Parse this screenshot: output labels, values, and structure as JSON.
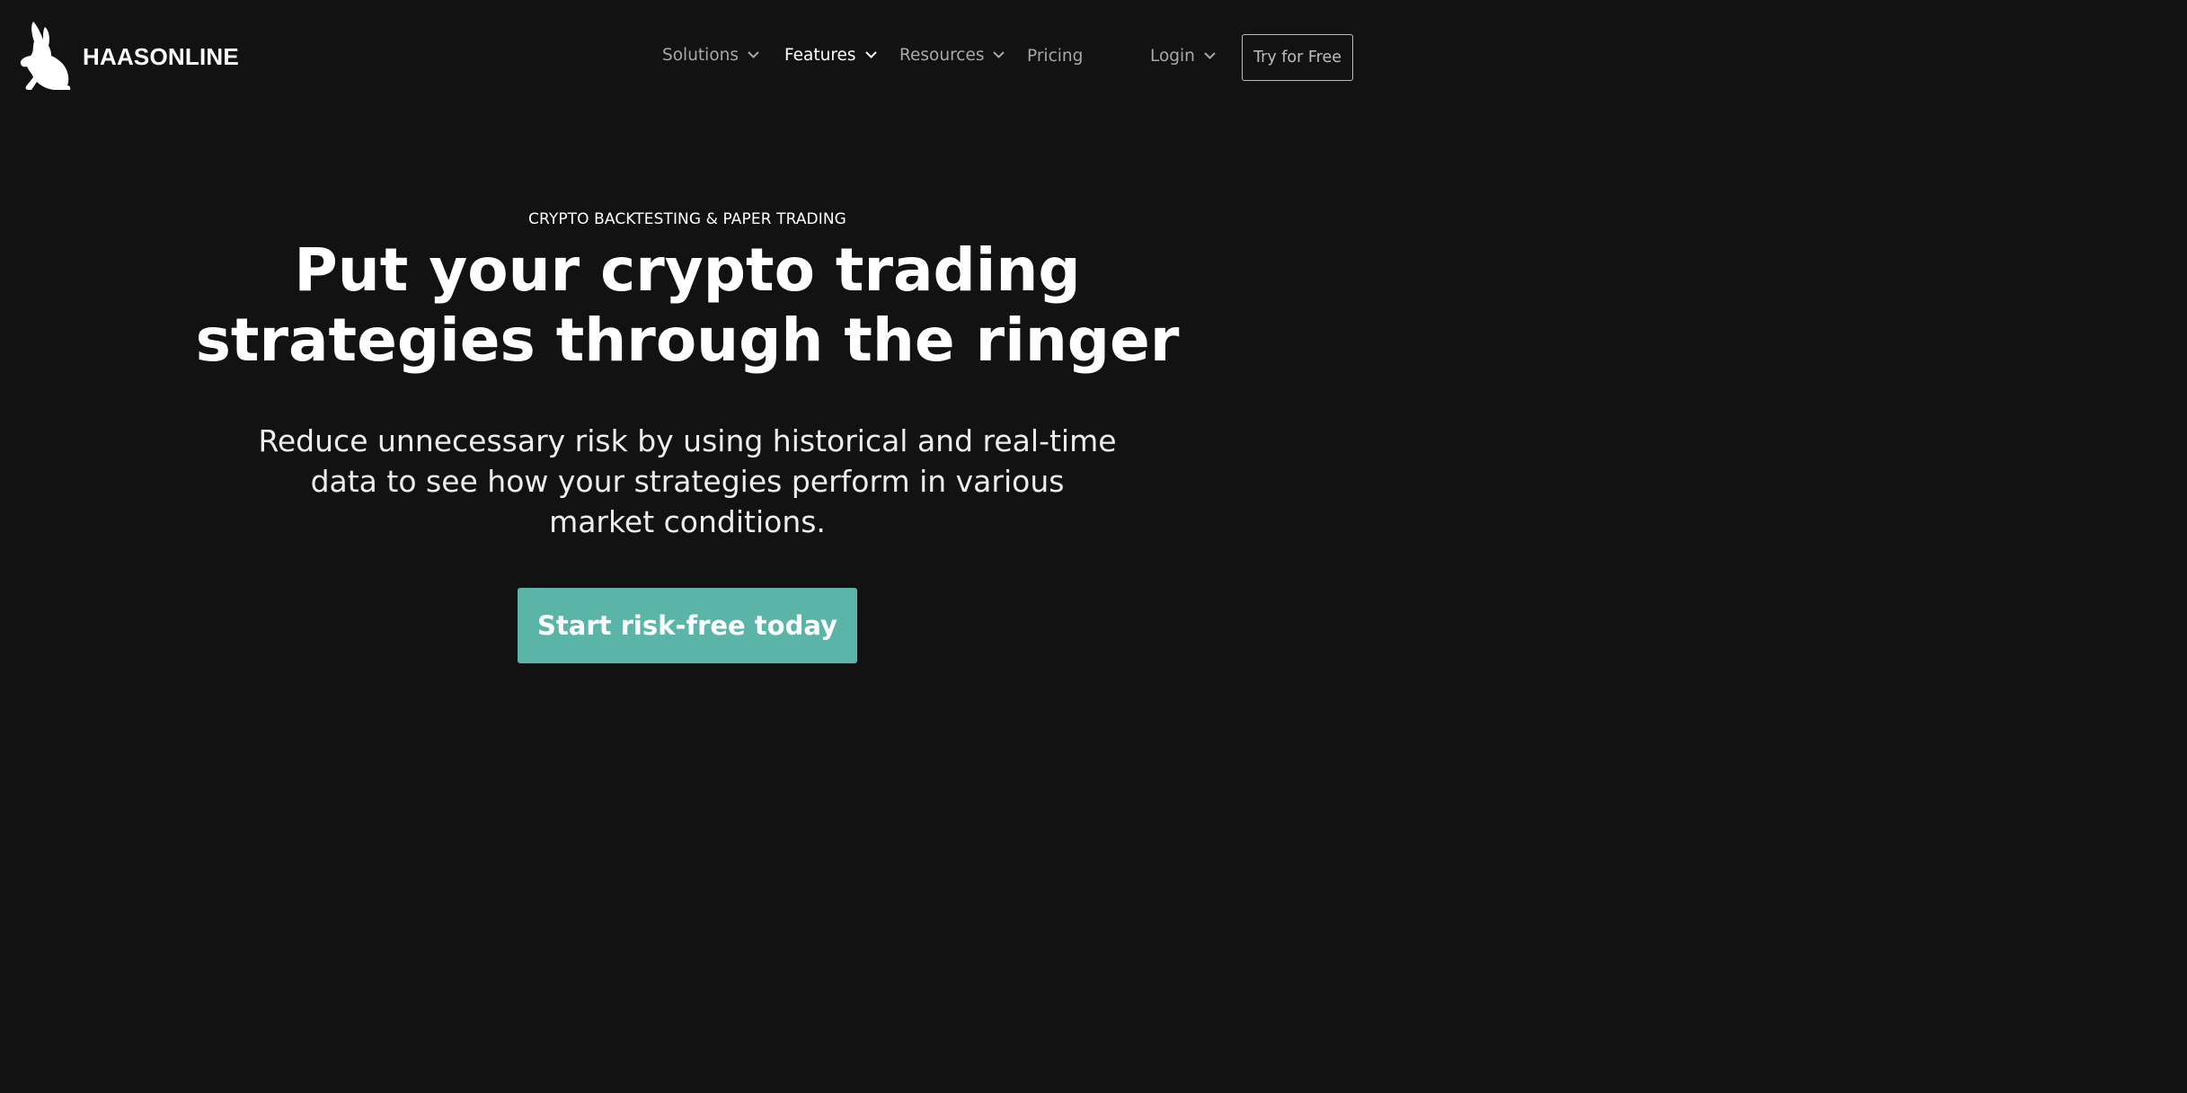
{
  "brand": {
    "name": "HAASONLINE",
    "logo_icon": "rabbit-icon"
  },
  "nav": {
    "solutions": "Solutions",
    "features": "Features",
    "resources": "Resources",
    "pricing": "Pricing",
    "login": "Login",
    "try_free": "Try for Free",
    "dropdown_icon": "chevron-down-icon",
    "active_item": "Features"
  },
  "hero": {
    "eyebrow": "CRYPTO BACKTESTING & PAPER TRADING",
    "headline_line1": "Put your crypto trading",
    "headline_line2": "strategies through the ringer",
    "subtext": "Reduce unnecessary risk by using historical and real-time data to see how your strategies perform in various market conditions.",
    "cta": "Start risk-free today"
  },
  "colors": {
    "background": "#121212",
    "accent": "#5ab5a8",
    "nav_text": "#a8a8a8",
    "nav_active": "#ffffff"
  }
}
